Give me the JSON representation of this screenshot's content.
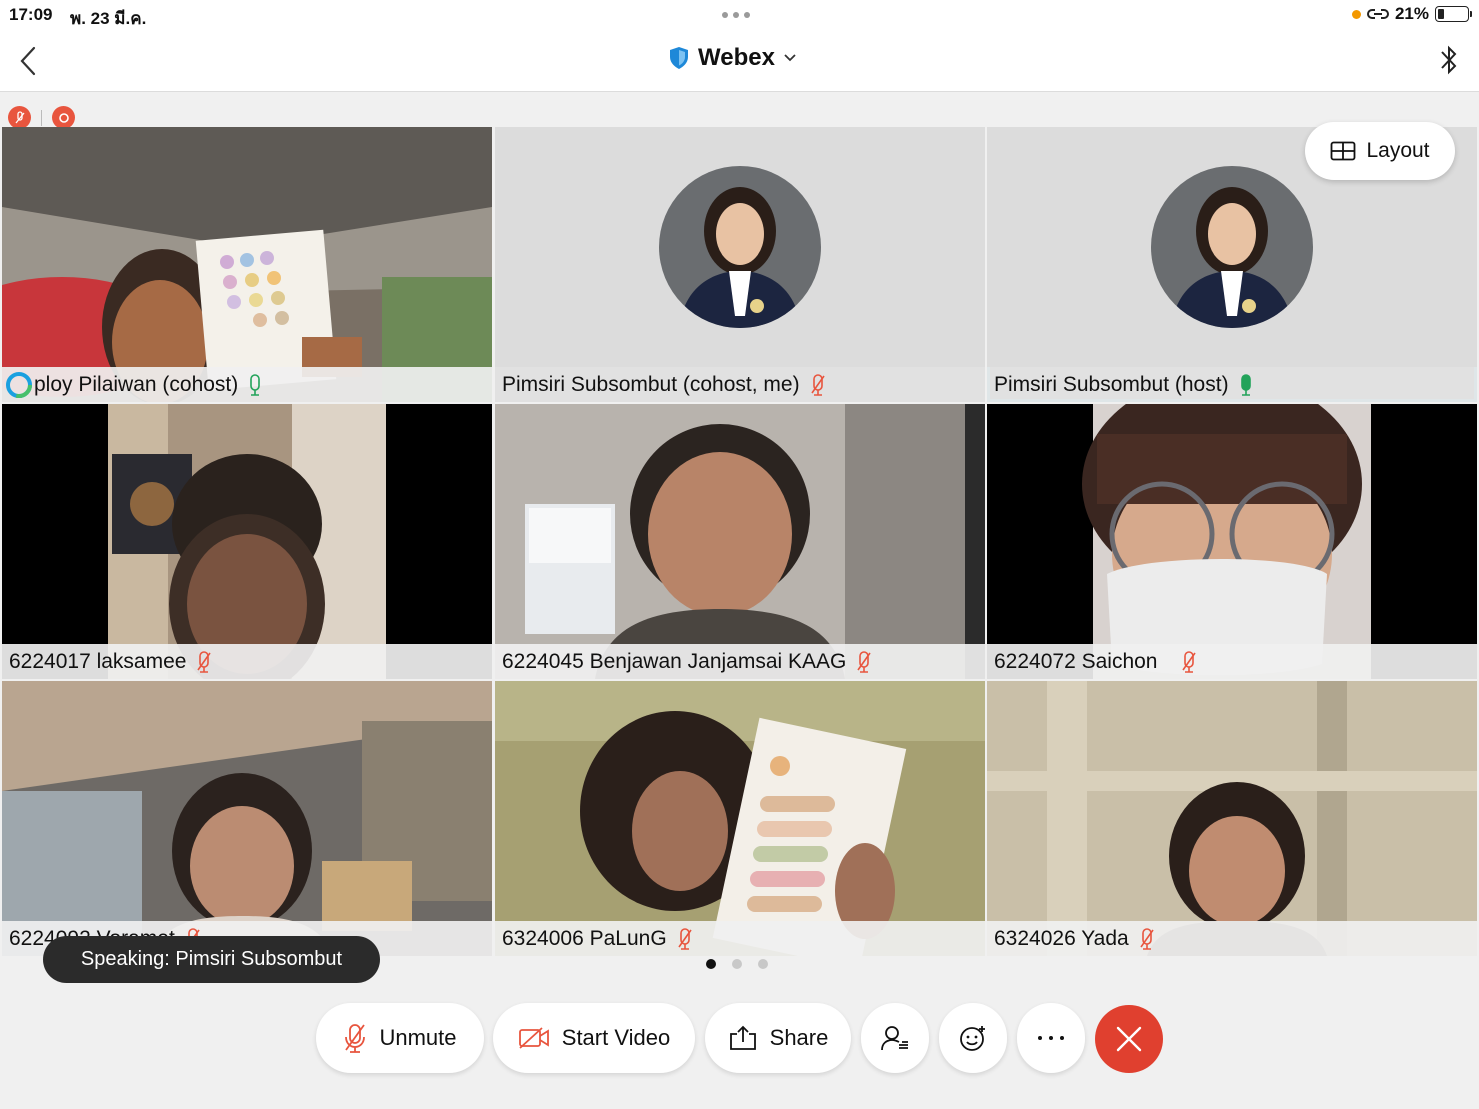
{
  "status_bar": {
    "time": "17:09",
    "date": "พ. 23 มี.ค.",
    "battery": "21%",
    "battery_level": 0.21
  },
  "nav": {
    "title": "Webex"
  },
  "layout_button": "Layout",
  "participants": [
    {
      "name": "ploy Pilaiwan (cohost)",
      "mic": "on",
      "video": true
    },
    {
      "name": "Pimsiri Subsombut (cohost, me)",
      "mic": "muted",
      "video": false
    },
    {
      "name": "Pimsiri Subsombut (host)",
      "mic": "speaking",
      "video": false,
      "highlighted": true
    },
    {
      "name": "6224017 laksamee",
      "mic": "muted",
      "video": true
    },
    {
      "name": "6224045 Benjawan Janjamsai KAAG",
      "mic": "muted",
      "video": true
    },
    {
      "name": "6224072 Saichon",
      "mic": "muted",
      "video": true
    },
    {
      "name": "6224092 Voramet",
      "mic": "muted",
      "video": true
    },
    {
      "name": "6324006 PaLunG",
      "mic": "muted",
      "video": true
    },
    {
      "name": "6324026 Yada",
      "mic": "muted",
      "video": true
    }
  ],
  "speaking_toast": "Speaking: Pimsiri Subsombut",
  "pager": {
    "pages": 3,
    "current": 1
  },
  "toolbar": {
    "unmute": "Unmute",
    "start_video": "Start Video",
    "share": "Share"
  },
  "colors": {
    "end_call": "#e0402f",
    "muted_icon": "#e8553e",
    "mic_on": "#22a35a",
    "highlight": "#1b6f8f"
  }
}
